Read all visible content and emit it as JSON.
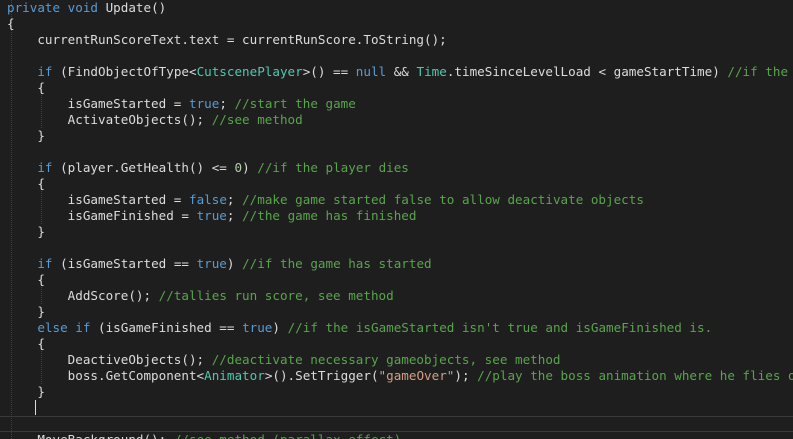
{
  "editor": {
    "language": "csharp",
    "colors": {
      "background": "#1e1e1e",
      "keyword": "#569cd6",
      "type": "#4ec9b0",
      "comment": "#57a64a",
      "string": "#d69d85",
      "number": "#b5cea8",
      "text": "#dcdcdc"
    },
    "caret_line": 26,
    "lines": [
      [
        {
          "c": "kw",
          "t": "private "
        },
        {
          "c": "kw",
          "t": "void"
        },
        {
          "c": "id",
          "t": " Update()"
        }
      ],
      [
        {
          "c": "id",
          "t": "{"
        }
      ],
      [
        {
          "c": "id",
          "t": "    currentRunScoreText.text = currentRunScore.ToString();"
        }
      ],
      [],
      [
        {
          "c": "kw",
          "t": "    if"
        },
        {
          "c": "id",
          "t": " (FindObjectOfType<"
        },
        {
          "c": "ty",
          "t": "CutscenePlayer"
        },
        {
          "c": "id",
          "t": ">() == "
        },
        {
          "c": "kw",
          "t": "null"
        },
        {
          "c": "id",
          "t": " && "
        },
        {
          "c": "ty",
          "t": "Time"
        },
        {
          "c": "id",
          "t": ".timeSinceLevelLoad < gameStartTime) "
        },
        {
          "c": "cm",
          "t": "//if the cutscene"
        }
      ],
      [
        {
          "c": "id",
          "t": "    {"
        }
      ],
      [
        {
          "c": "id",
          "t": "        isGameStarted = "
        },
        {
          "c": "kw",
          "t": "true"
        },
        {
          "c": "id",
          "t": "; "
        },
        {
          "c": "cm",
          "t": "//start the game"
        }
      ],
      [
        {
          "c": "id",
          "t": "        ActivateObjects(); "
        },
        {
          "c": "cm",
          "t": "//see method"
        }
      ],
      [
        {
          "c": "id",
          "t": "    }"
        }
      ],
      [],
      [
        {
          "c": "kw",
          "t": "    if"
        },
        {
          "c": "id",
          "t": " (player.GetHealth() <= "
        },
        {
          "c": "nu",
          "t": "0"
        },
        {
          "c": "id",
          "t": ") "
        },
        {
          "c": "cm",
          "t": "//if the player dies"
        }
      ],
      [
        {
          "c": "id",
          "t": "    {"
        }
      ],
      [
        {
          "c": "id",
          "t": "        isGameStarted = "
        },
        {
          "c": "kw",
          "t": "false"
        },
        {
          "c": "id",
          "t": "; "
        },
        {
          "c": "cm",
          "t": "//make game started false to allow deactivate objects"
        }
      ],
      [
        {
          "c": "id",
          "t": "        isGameFinished = "
        },
        {
          "c": "kw",
          "t": "true"
        },
        {
          "c": "id",
          "t": "; "
        },
        {
          "c": "cm",
          "t": "//the game has finished"
        }
      ],
      [
        {
          "c": "id",
          "t": "    }"
        }
      ],
      [],
      [
        {
          "c": "kw",
          "t": "    if"
        },
        {
          "c": "id",
          "t": " (isGameStarted == "
        },
        {
          "c": "kw",
          "t": "true"
        },
        {
          "c": "id",
          "t": ") "
        },
        {
          "c": "cm",
          "t": "//if the game has started"
        }
      ],
      [
        {
          "c": "id",
          "t": "    {"
        }
      ],
      [
        {
          "c": "id",
          "t": "        AddScore(); "
        },
        {
          "c": "cm",
          "t": "//tallies run score, see method"
        }
      ],
      [
        {
          "c": "id",
          "t": "    }"
        }
      ],
      [
        {
          "c": "kw",
          "t": "    else if"
        },
        {
          "c": "id",
          "t": " (isGameFinished == "
        },
        {
          "c": "kw",
          "t": "true"
        },
        {
          "c": "id",
          "t": ") "
        },
        {
          "c": "cm",
          "t": "//if the isGameStarted isn't true and isGameFinished is."
        }
      ],
      [
        {
          "c": "id",
          "t": "    {"
        }
      ],
      [
        {
          "c": "id",
          "t": "        DeactiveObjects(); "
        },
        {
          "c": "cm",
          "t": "//deactivate necessary gameobjects, see method"
        }
      ],
      [
        {
          "c": "id",
          "t": "        boss.GetComponent<"
        },
        {
          "c": "ty",
          "t": "Animator"
        },
        {
          "c": "id",
          "t": ">().SetTrigger("
        },
        {
          "c": "st",
          "t": "\"gameOver\""
        },
        {
          "c": "id",
          "t": "); "
        },
        {
          "c": "cm",
          "t": "//play the boss animation where he flies off screen"
        }
      ],
      [
        {
          "c": "id",
          "t": "    }"
        }
      ],
      [],
      [
        {
          "c": "id",
          "t": "    "
        }
      ],
      [
        {
          "c": "id",
          "t": "    MoveBackground(); "
        },
        {
          "c": "cm",
          "t": "//see method (parallax effect)"
        }
      ]
    ]
  }
}
